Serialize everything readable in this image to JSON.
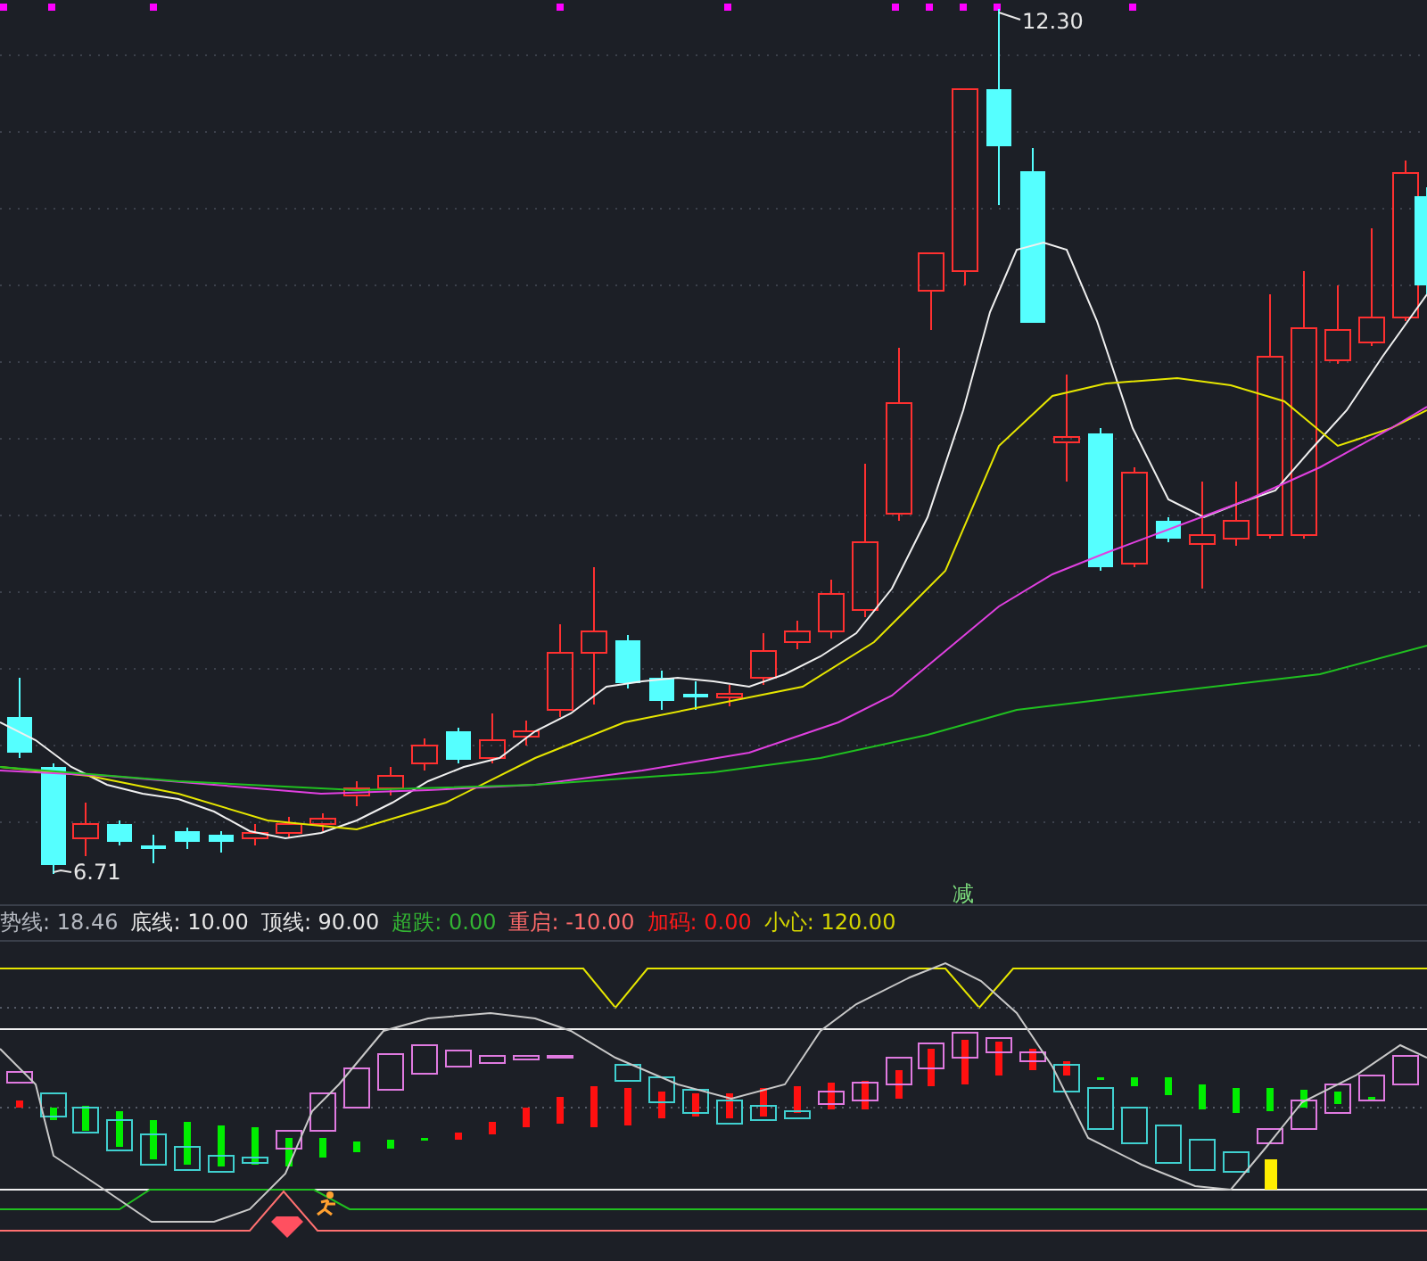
{
  "price_chart": {
    "high_label": "12.30",
    "low_label": "6.71",
    "signal_label": "减"
  },
  "indicator": {
    "items": [
      {
        "text": "势线: 18.46",
        "color": "#b4b8c0"
      },
      {
        "text": "底线: 10.00",
        "color": "#e6e6e6"
      },
      {
        "text": "顶线: 90.00",
        "color": "#e6e6e6"
      },
      {
        "text": "超跌: 0.00",
        "color": "#33b533"
      },
      {
        "text": "重启: -10.00",
        "color": "#ff6b6b"
      },
      {
        "text": "加码: 0.00",
        "color": "#ff1a1a"
      },
      {
        "text": "小心: 120.00",
        "color": "#d4d400"
      }
    ]
  }
}
